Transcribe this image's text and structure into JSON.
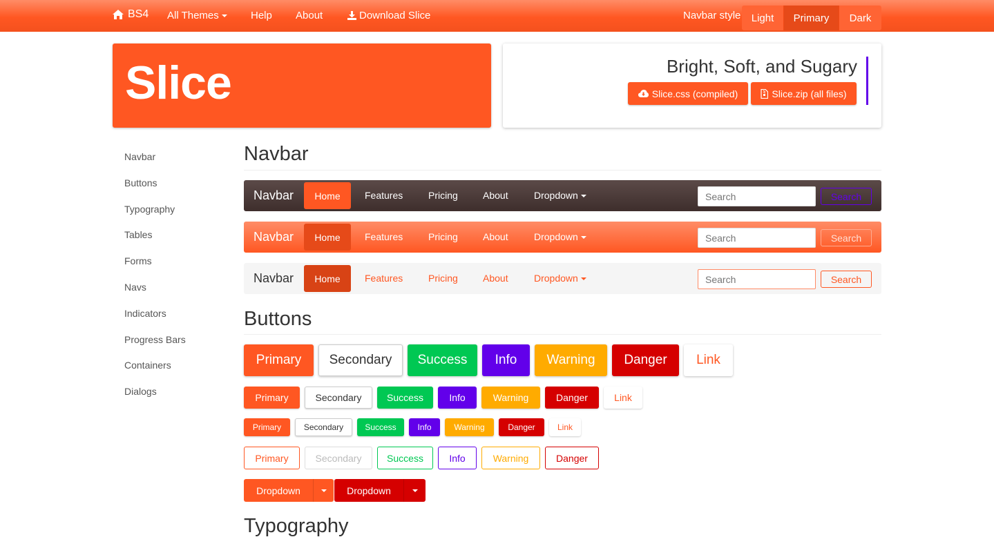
{
  "topbar": {
    "brand": "BS4",
    "themes": "All Themes",
    "help": "Help",
    "about": "About",
    "download": "Download Slice",
    "style_label": "Navbar style",
    "styles": [
      "Light",
      "Primary",
      "Dark"
    ]
  },
  "hero": {
    "title": "Slice"
  },
  "promo": {
    "tagline": "Bright, Soft, and Sugary",
    "css_button": "Slice.css (compiled)",
    "zip_button": "Slice.zip (all files)"
  },
  "sidebar": {
    "items": [
      "Navbar",
      "Buttons",
      "Typography",
      "Tables",
      "Forms",
      "Navs",
      "Indicators",
      "Progress Bars",
      "Containers",
      "Dialogs"
    ]
  },
  "sections": {
    "navbar": "Navbar",
    "buttons": "Buttons",
    "typography": "Typography"
  },
  "demo_navbar": {
    "brand": "Navbar",
    "links": [
      "Home",
      "Features",
      "Pricing",
      "About",
      "Dropdown"
    ],
    "search_placeholder": "Search",
    "search_button": "Search"
  },
  "buttons": {
    "labels": [
      "Primary",
      "Secondary",
      "Success",
      "Info",
      "Warning",
      "Danger",
      "Link"
    ],
    "dropdown": "Dropdown"
  },
  "colors": {
    "primary": "#ff5722",
    "success": "#00c853",
    "info": "#6200ea",
    "warning": "#ffab00",
    "danger": "#d50000"
  }
}
